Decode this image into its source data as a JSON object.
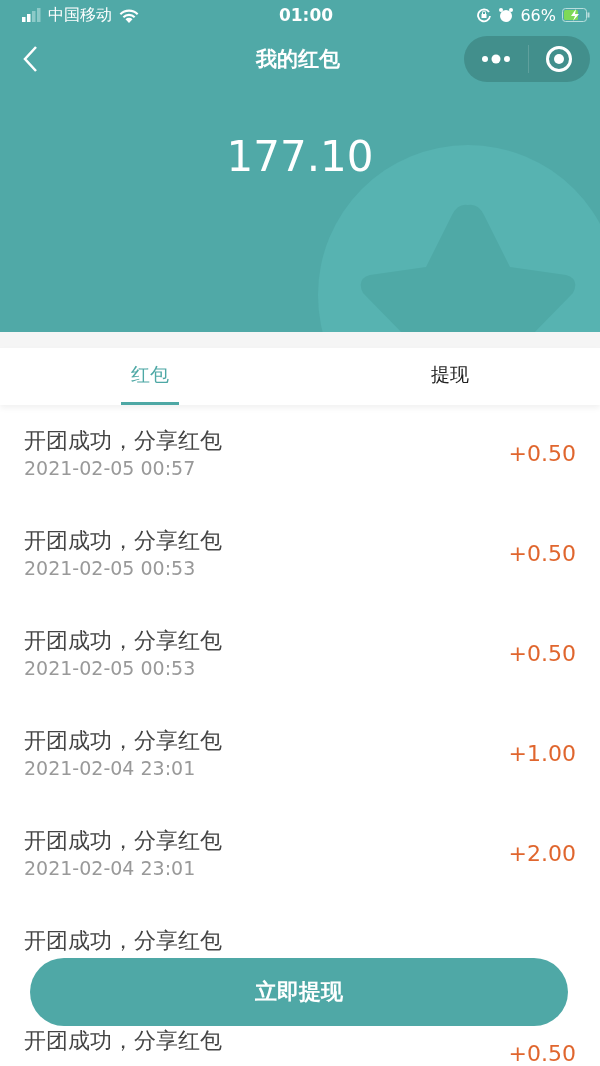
{
  "status_bar": {
    "carrier": "中国移动",
    "time": "01:00",
    "battery": "66%"
  },
  "nav": {
    "title": "我的红包"
  },
  "balance": "177.10",
  "tabs": [
    {
      "label": "红包",
      "selected": true
    },
    {
      "label": "提现",
      "selected": false
    }
  ],
  "records": [
    {
      "title": "开团成功，分享红包",
      "date": "2021-02-05 00:57",
      "amount": "+0.50"
    },
    {
      "title": "开团成功，分享红包",
      "date": "2021-02-05 00:53",
      "amount": "+0.50"
    },
    {
      "title": "开团成功，分享红包",
      "date": "2021-02-05 00:53",
      "amount": "+0.50"
    },
    {
      "title": "开团成功，分享红包",
      "date": "2021-02-04 23:01",
      "amount": "+1.00"
    },
    {
      "title": "开团成功，分享红包",
      "date": "2021-02-04 23:01",
      "amount": "+2.00"
    },
    {
      "title": "开团成功，分享红包"
    },
    {
      "title": "开团成功，分享红包",
      "amount": "+0.50"
    }
  ],
  "withdraw_button": "立即提现"
}
